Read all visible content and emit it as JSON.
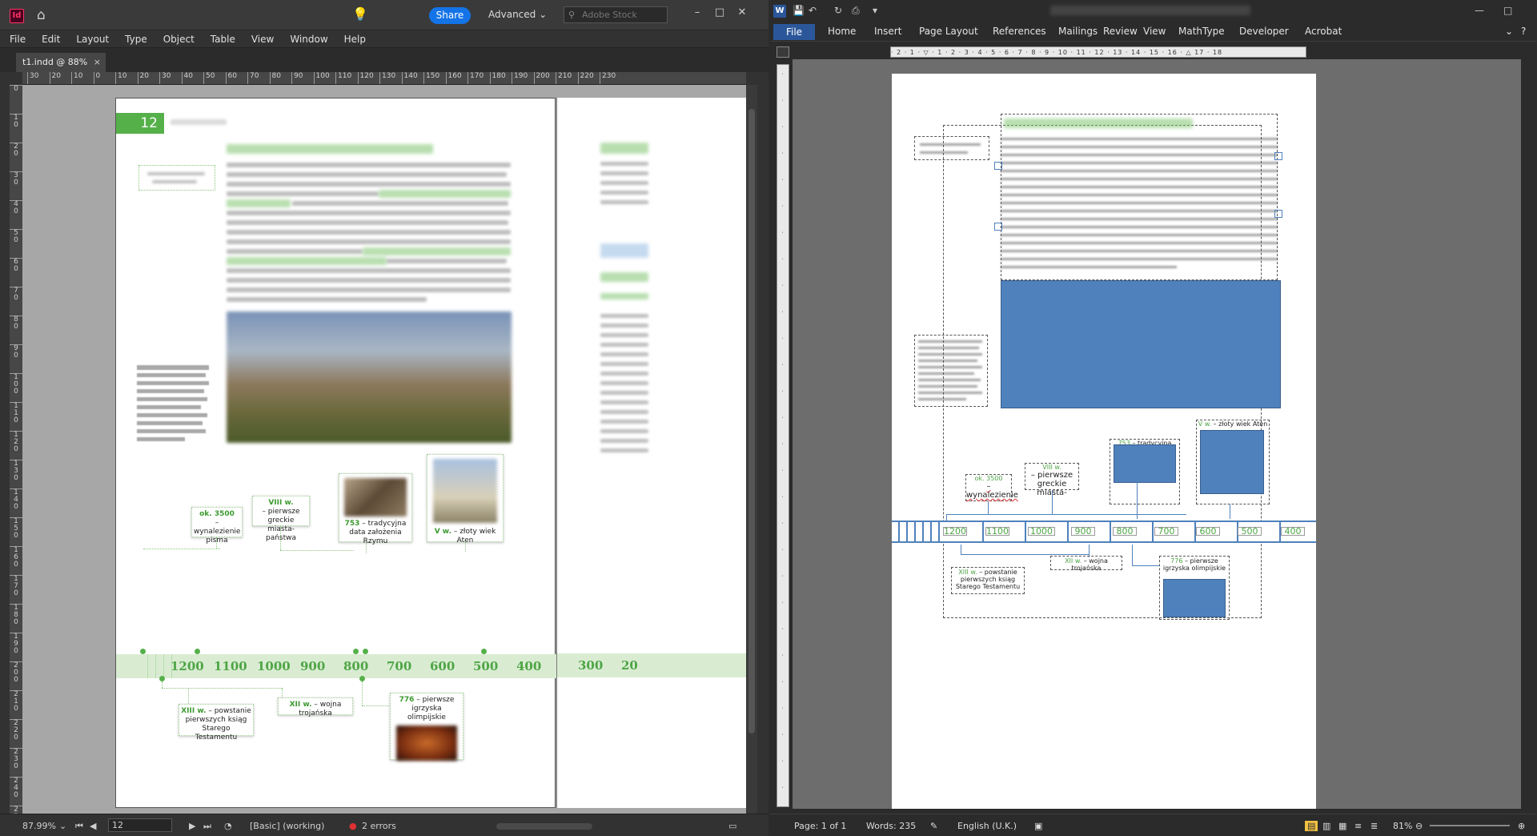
{
  "indesign": {
    "app_icon": "Id",
    "share_label": "Share",
    "workspace_label": "Advanced",
    "stock_placeholder": "Adobe Stock",
    "menu": [
      "File",
      "Edit",
      "Layout",
      "Type",
      "Object",
      "Table",
      "View",
      "Window",
      "Help"
    ],
    "doc_tab": "t1.indd @ 88%",
    "ruler_h": [
      "30",
      "20",
      "10",
      "0",
      "10",
      "20",
      "30",
      "40",
      "50",
      "60",
      "70",
      "80",
      "90",
      "100",
      "110",
      "120",
      "130",
      "140",
      "150",
      "160",
      "170",
      "180",
      "190",
      "200",
      "210",
      "220",
      "230"
    ],
    "ruler_v": [
      "0",
      "1 0",
      "2 0",
      "3 0",
      "4 0",
      "5 0",
      "6 0",
      "7 0",
      "8 0",
      "9 0",
      "1 0 0",
      "1 1 0",
      "1 2 0",
      "1 3 0",
      "1 4 0",
      "1 5 0",
      "1 6 0",
      "1 7 0",
      "1 8 0",
      "1 9 0",
      "2 0 0",
      "2 1 0",
      "2 2 0",
      "2 3 0",
      "2 4 0",
      "2 5 0"
    ],
    "page_number": "12",
    "timeline_numbers": [
      "1200",
      "1100",
      "1000",
      "900",
      "800",
      "700",
      "600",
      "500",
      "400",
      "300",
      "20"
    ],
    "timeline_boxes": {
      "b3500_year": "ok. 3500",
      "b3500_text": "– wynalezienie pisma",
      "b8_year": "VIII w.",
      "b8_text": "– pierwsze greckie miasta-państwa",
      "b753_year": "753",
      "b753_text": "– tradycyjna data założenia Rzymu",
      "b5_year": "V w.",
      "b5_text": "– złoty wiek Aten",
      "b13_year": "XIII w.",
      "b13_text": "– powstanie pierwszych ksiąg Starego Testamentu",
      "b12_year": "XII w.",
      "b12_text": "– wojna trojańska",
      "b776_year": "776",
      "b776_text": "– pierwsze igrzyska olimpijskie"
    },
    "status": {
      "zoom": "87.99%",
      "page": "12",
      "style": "[Basic] (working)",
      "errors": "2 errors"
    }
  },
  "word": {
    "tabs": [
      "File",
      "Home",
      "Insert",
      "Page Layout",
      "References",
      "Mailings",
      "Review",
      "View",
      "MathType",
      "Developer",
      "Acrobat"
    ],
    "ruler_h": "· 2 · 1 · ▽ · 1 · 2 · 3 · 4 · 5 · 6 · 7 · 8 · 9 · 10 · 11 · 12 · 13 · 14 · 15 · 16 · △ 17 · 18",
    "timeline_numbers": [
      "1200",
      "1100",
      "1000",
      "900",
      "800",
      "700",
      "600",
      "500",
      "400"
    ],
    "boxes": {
      "b3500_year": "ok. 3500",
      "b3500_text": "– wynalezienie",
      "b8_year": "VIII w.",
      "b8_text": "– pierwsze greckie miasta-",
      "b753_year": "753",
      "b753_text": "– tradycyjna data założenia Rzymu",
      "b5_year": "V w.",
      "b5_text": "– złoty wiek Aten",
      "b13_year": "XIII w.",
      "b13_text": "– powstanie pierwszych ksiąg Starego Testamentu",
      "b12_year": "XII w.",
      "b12_text": "– wojna trojańska",
      "b776_year": "776",
      "b776_text": "– pierwsze igrzyska olimpijskie"
    },
    "status": {
      "page": "Page: 1 of 1",
      "words": "Words: 235",
      "lang": "English (U.K.)",
      "zoom": "81%"
    }
  },
  "colors": {
    "accent_green": "#56b04a",
    "word_blue": "#2b579a",
    "shape_blue": "#4f81bd",
    "share_blue": "#1473e6"
  }
}
